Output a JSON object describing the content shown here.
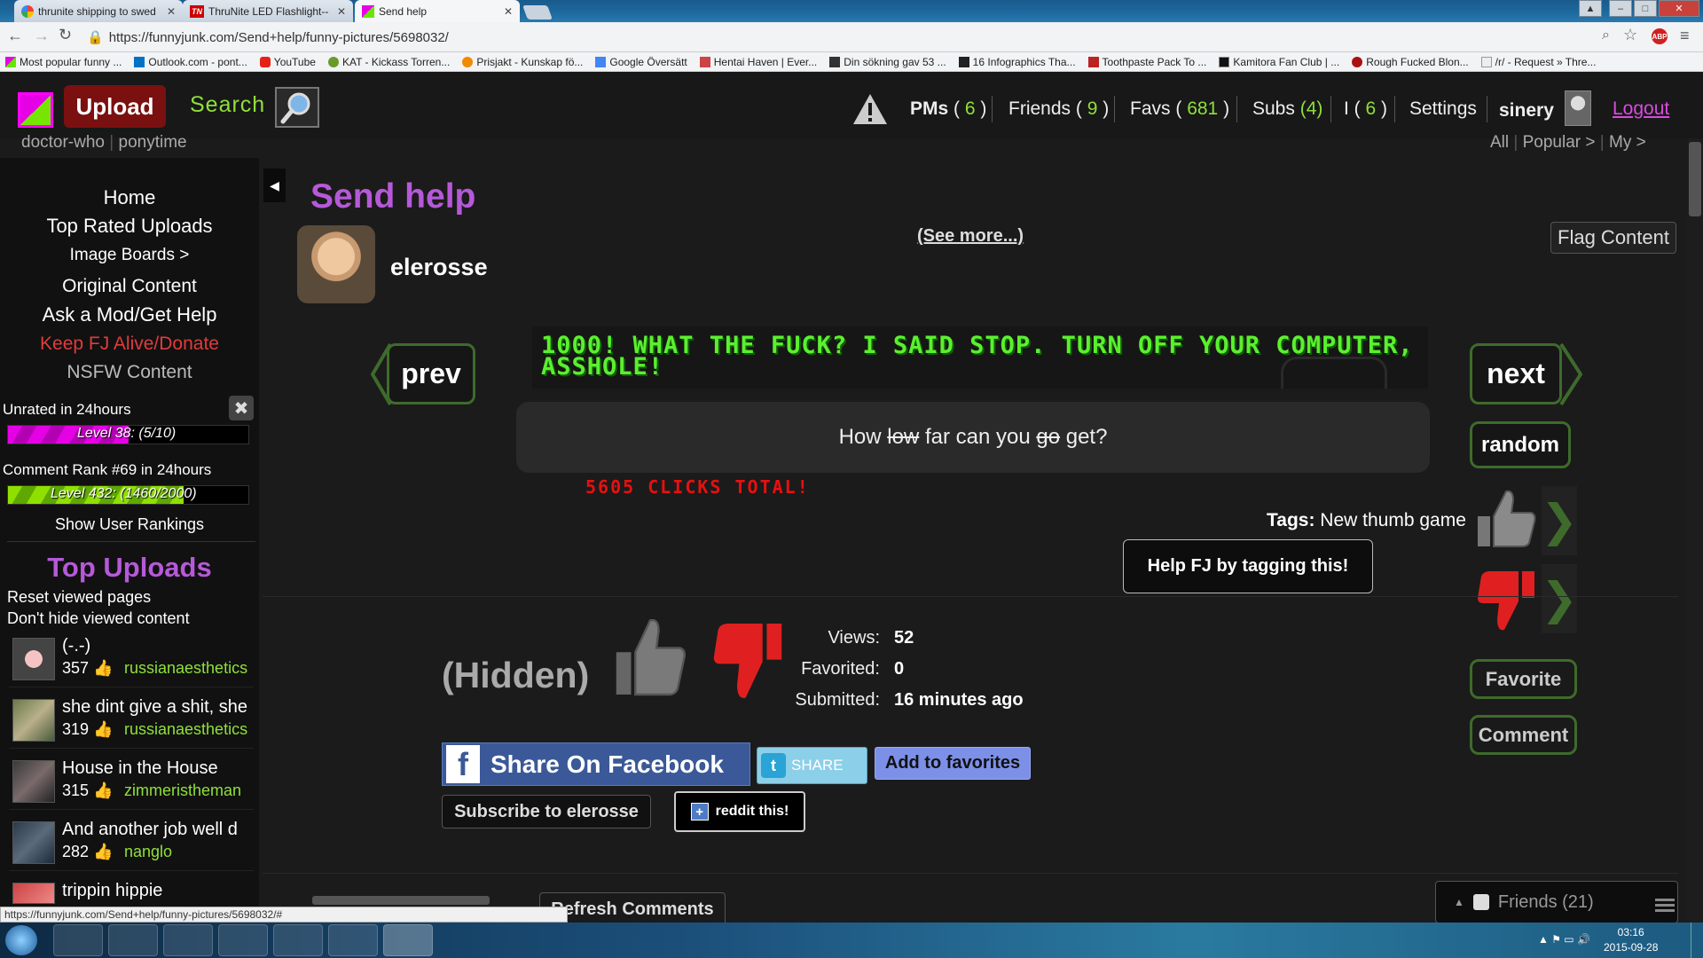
{
  "browser": {
    "tabs": [
      {
        "title": "thrunite shipping to swed"
      },
      {
        "title": "ThruNite LED Flashlight--"
      },
      {
        "title": "Send help"
      }
    ],
    "url": "https://funnyjunk.com/Send+help/funny-pictures/5698032/",
    "bookmarks": [
      "Most popular funny ...",
      "Outlook.com - pont...",
      "YouTube",
      "KAT - Kickass Torren...",
      "Prisjakt - Kunskap fö...",
      "Google Översätt",
      "Hentai Haven | Ever...",
      "Din sökning gav 53 ...",
      "16 Infographics Tha...",
      "Toothpaste Pack To ...",
      "Kamitora Fan Club | ...",
      "Rough Fucked Blon...",
      "/r/ - Request » Thre..."
    ],
    "status_url": "https://funnyjunk.com/Send+help/funny-pictures/5698032/#"
  },
  "header": {
    "upload_label": "Upload",
    "search_label": "Search",
    "pms_label": "PMs",
    "pms_count": "6",
    "friends_label": "Friends",
    "friends_count": "9",
    "favs_label": "Favs",
    "favs_count": "681",
    "subs_label": "Subs",
    "subs_count": "(4)",
    "i_label": "I",
    "i_count": "6",
    "settings_label": "Settings",
    "username": "sinery",
    "logout_label": "Logout",
    "subnav_left": [
      "doctor-who",
      "ponytime"
    ],
    "subnav_right": [
      "All",
      "Popular >",
      "My >"
    ]
  },
  "sidebar": {
    "nav": [
      "Home",
      "Top Rated Uploads",
      "Image Boards >",
      "Original Content",
      "Ask a Mod/Get Help",
      "Keep FJ Alive/Donate",
      "NSFW Content"
    ],
    "unrated_label": "Unrated in 24hours",
    "unrated_level": "Level 38: (5/10)",
    "unrated_progress": 0.5,
    "comment_rank_label": "Comment Rank #69 in 24hours",
    "comment_level": "Level 432: (1460/2000)",
    "comment_progress": 0.73,
    "show_rankings": "Show User Rankings",
    "top_uploads_title": "Top Uploads",
    "reset_viewed": "Reset viewed pages",
    "dont_hide": "Don't hide viewed content",
    "top_uploads": [
      {
        "title": "(-.-)",
        "score": "357",
        "user": "russianaesthetics"
      },
      {
        "title": "she dint give a shit, she",
        "score": "319",
        "user": "russianaesthetics"
      },
      {
        "title": "House in the House",
        "score": "315",
        "user": "zimmeristheman"
      },
      {
        "title": "And another job well d",
        "score": "282",
        "user": "nanglo"
      },
      {
        "title": "trippin hippie",
        "score": "",
        "user": ""
      }
    ]
  },
  "content": {
    "title": "Send help",
    "author": "elerosse",
    "see_more": "(See more...)",
    "flag_label": "Flag Content",
    "prev_label": "prev",
    "next_label": "next",
    "random_label": "random",
    "meme_text": "1000! WHAT THE FUCK? I SAID STOP. TURN OFF YOUR COMPUTER, ASSHOLE!",
    "question_parts": [
      "How",
      "low",
      "far can you",
      "go",
      "get?"
    ],
    "clicks_text": "5605 CLICKS TOTAL!",
    "tags_label": "Tags:",
    "tags_value": "New thumb game",
    "tag_help_button": "Help FJ by tagging this!",
    "hidden_label": "(Hidden)",
    "views_label": "Views:",
    "views_value": "52",
    "favorited_label": "Favorited:",
    "favorited_value": "0",
    "submitted_label": "Submitted:",
    "submitted_value": "16 minutes ago",
    "facebook_share": "Share On Facebook",
    "twitter_share": "SHARE",
    "add_favorites": "Add to favorites",
    "subscribe_label": "Subscribe to elerosse",
    "reddit_label": "reddit this!",
    "favorite_button": "Favorite",
    "comment_button": "Comment",
    "refresh_comments": "Refresh Comments",
    "friends_panel": "Friends (21)"
  },
  "taskbar": {
    "time": "03:16",
    "date": "2015-09-28"
  },
  "colors": {
    "accent_purple": "#b659d9",
    "accent_green": "#8fe03a",
    "downvote_red": "#e02020",
    "upload_red": "#7a1010"
  }
}
